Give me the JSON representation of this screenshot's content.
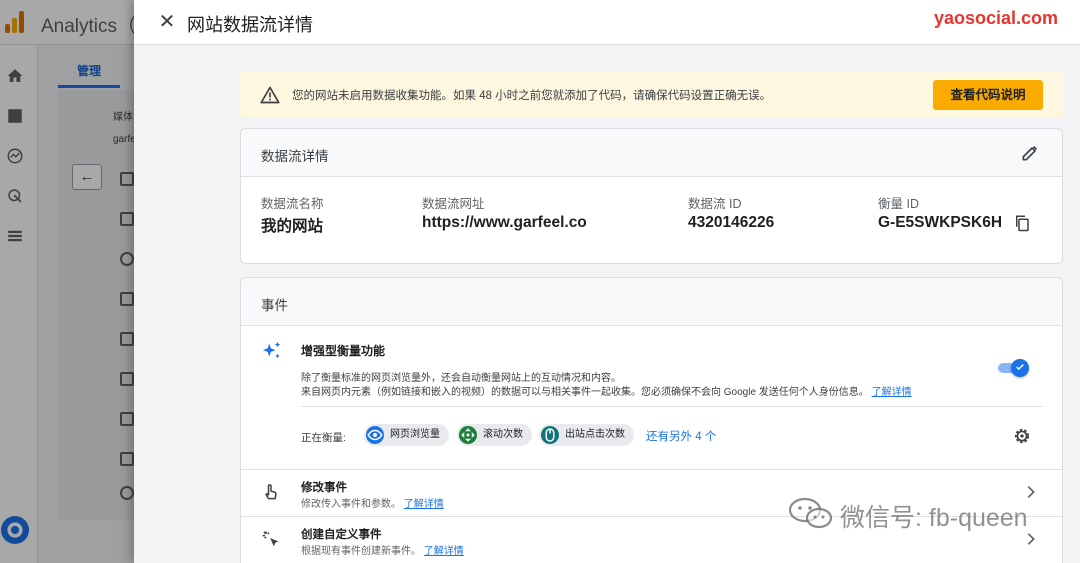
{
  "background_app": {
    "app_name": "Analytics（",
    "active_tab": "管理",
    "column_texts": [
      "媒体",
      "garfe"
    ]
  },
  "drawer": {
    "title": "网站数据流详情",
    "brand_watermark": "yaosocial.com"
  },
  "warning": {
    "text": "您的网站未启用数据收集功能。如果 48 小时之前您就添加了代码，请确保代码设置正确无误。",
    "button_label": "查看代码说明"
  },
  "stream_details": {
    "title": "数据流详情",
    "fields": [
      {
        "label": "数据流名称",
        "value": "我的网站"
      },
      {
        "label": "数据流网址",
        "value": "https://www.garfeel.co"
      },
      {
        "label": "数据流 ID",
        "value": "4320146226"
      },
      {
        "label": "衡量 ID",
        "value": "G-E5SWKPSK6H"
      }
    ]
  },
  "events": {
    "title": "事件",
    "enhanced": {
      "title": "增强型衡量功能",
      "desc_line1": "除了衡量标准的网页浏览量外，还会自动衡量网站上的互动情况和内容。",
      "desc_line2": "来自网页内元素（例如链接和嵌入的视频）的数据可以与相关事件一起收集。您必须确保不会向 Google 发送任何个人身份信息。",
      "learn_more": "了解详情",
      "toggle_on": true
    },
    "measuring_label": "正在衡量:",
    "chips": [
      {
        "label": "网页浏览量",
        "icon": "eye-icon",
        "color": "#1a73e8"
      },
      {
        "label": "滚动次数",
        "icon": "scroll-icon",
        "color": "#188038"
      },
      {
        "label": "出站点击次数",
        "icon": "mouse-icon",
        "color": "#12737a"
      }
    ],
    "more_link": "还有另外 4 个",
    "rows": [
      {
        "title": "修改事件",
        "desc": "修改传入事件和参数。",
        "learn_more": "了解详情"
      },
      {
        "title": "创建自定义事件",
        "desc": "根据现有事件创建新事件。",
        "learn_more": "了解详情"
      }
    ]
  },
  "overlay_watermark": {
    "text": "微信号: fb-queen"
  },
  "colors": {
    "accent": "#1a73e8",
    "warning_bg": "#fef7e0",
    "warning_button": "#f9ab00",
    "brand_red": "#e8352b"
  }
}
